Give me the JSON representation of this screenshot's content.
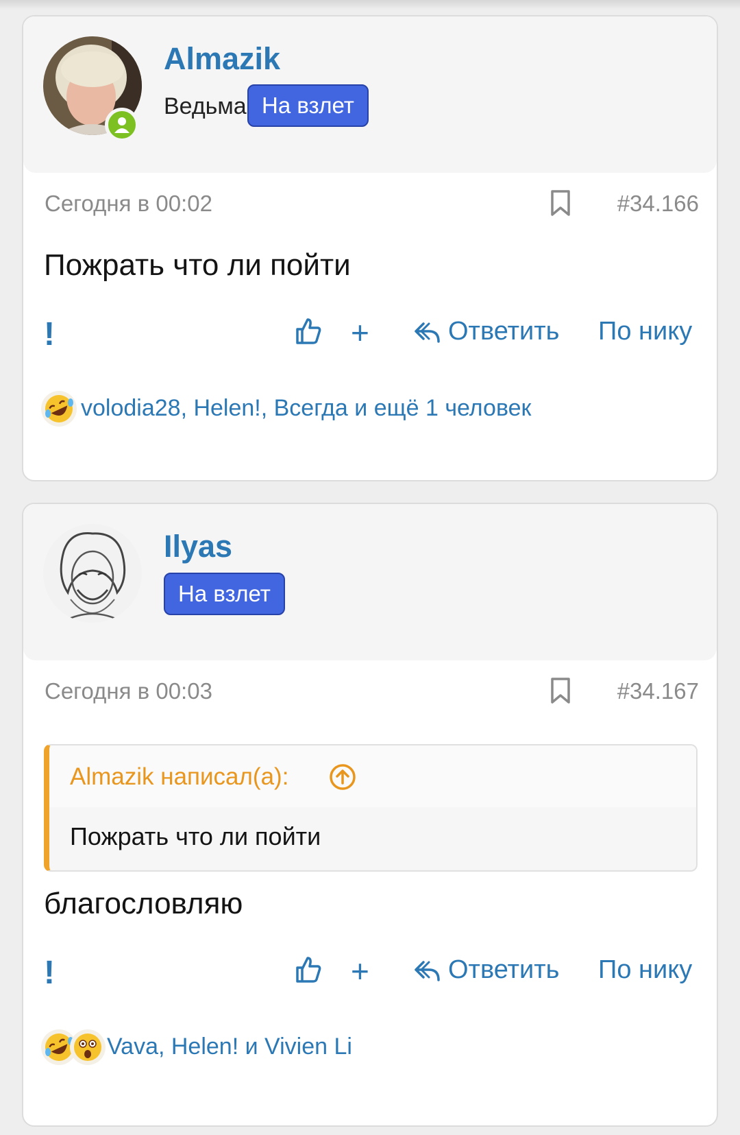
{
  "posts": [
    {
      "username": "Almazik",
      "user_title": "Ведьма",
      "badge": "На взлет",
      "online": true,
      "date": "Сегодня в 00:02",
      "number": "#34.166",
      "message": "Пожрать что ли пойти",
      "actions": {
        "report": "!",
        "add": "+",
        "reply": "Ответить",
        "by_nick": "По нику"
      },
      "reactions_text": "volodia28, Helen!, Всегда и ещё 1 человек",
      "reaction_icons": [
        "rofl-emoji"
      ]
    },
    {
      "username": "Ilyas",
      "badge": "На взлет",
      "date": "Сегодня в 00:03",
      "number": "#34.167",
      "quote": {
        "author": "Almazik написал(а):",
        "text": "Пожрать что ли пойти"
      },
      "message": "благословляю",
      "actions": {
        "report": "!",
        "add": "+",
        "reply": "Ответить",
        "by_nick": "По нику"
      },
      "reactions_text": "Vava, Helen! и Vivien Li",
      "reaction_icons": [
        "rofl-emoji",
        "astonished-emoji"
      ]
    }
  ],
  "colors": {
    "link": "#2b78b4",
    "badge": "#4166e0",
    "online": "#7cc021",
    "quote_accent": "#f0a32a"
  }
}
